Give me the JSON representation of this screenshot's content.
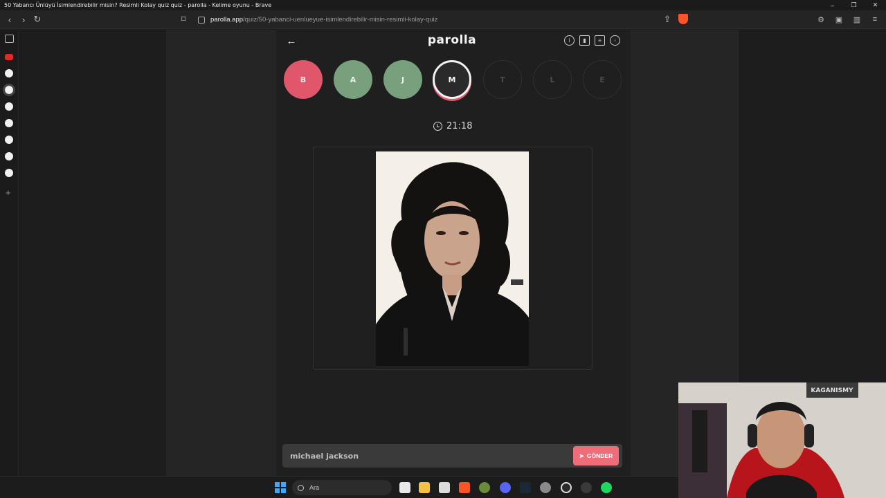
{
  "window": {
    "title": "50 Yabancı Ünlüyü İsimlendirebilir misin? Resimli Kolay quiz quiz - parolla - Kelime oyunu - Brave",
    "controls": [
      "minimize",
      "restore",
      "close"
    ]
  },
  "addressbar": {
    "domain": "parolla.app",
    "path": "/quiz/50-yabanci-uenlueyue-isimlendirebilir-misin-resimli-kolay-quiz"
  },
  "app": {
    "logo": "parolla",
    "header_icons": [
      "info-icon",
      "stats-icon",
      "chat-icon",
      "profile-icon"
    ]
  },
  "letters": [
    {
      "letter": "B",
      "state": "wrong"
    },
    {
      "letter": "A",
      "state": "correct"
    },
    {
      "letter": "J",
      "state": "correct"
    },
    {
      "letter": "M",
      "state": "current"
    },
    {
      "letter": "T",
      "state": "pending"
    },
    {
      "letter": "L",
      "state": "pending"
    },
    {
      "letter": "E",
      "state": "pending"
    }
  ],
  "timer": "21:18",
  "answer": {
    "value": "michael jackson",
    "send_label": "GÖNDER"
  },
  "taskbar": {
    "search_label": "Ara"
  },
  "webcam": {
    "sign_text": "KAGANISMY"
  },
  "colors": {
    "wrong": "#e0566a",
    "correct": "#78a07c",
    "accent": "#ee6d78"
  }
}
